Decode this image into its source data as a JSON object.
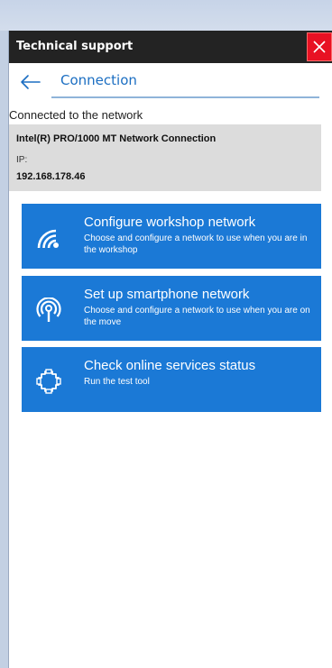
{
  "window": {
    "title": "Technical support",
    "close_icon": "close-icon"
  },
  "nav": {
    "back_icon": "arrow-left-icon",
    "title": "Connection"
  },
  "connection": {
    "status_label": "Connected to the network",
    "adapter": "Intel(R) PRO/1000 MT Network Connection",
    "ip_label": "IP:",
    "ip_value": "192.168.178.46"
  },
  "actions": [
    {
      "icon": "wifi-icon",
      "title": "Configure workshop network",
      "description": "Choose and configure a network to use when you are in the workshop"
    },
    {
      "icon": "antenna-icon",
      "title": "Set up smartphone network",
      "description": "Choose and configure a network to use when you are on the move"
    },
    {
      "icon": "services-status-icon",
      "title": "Check online services status",
      "description": "Run the test tool"
    }
  ],
  "colors": {
    "accent": "#1b79d6",
    "titlebar": "#232323",
    "close": "#e81123",
    "nav_text": "#1b6ec2",
    "info_bg": "#dcdcdc"
  }
}
